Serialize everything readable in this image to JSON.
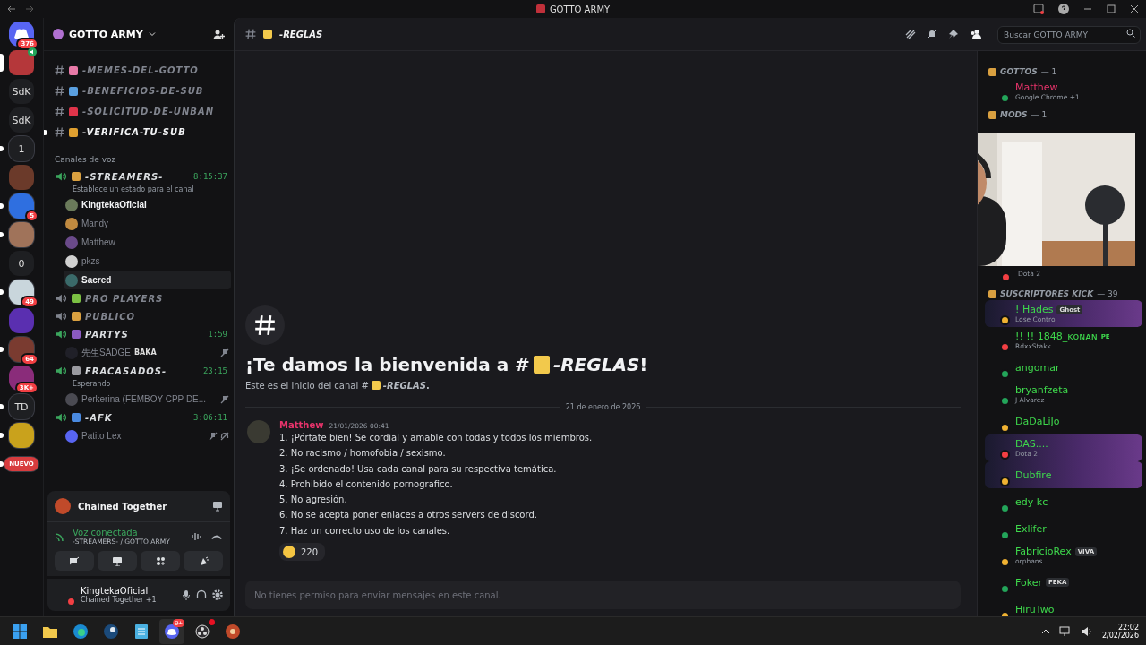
{
  "titlebar": {
    "title": "GOTTO ARMY"
  },
  "servers": [
    {
      "kind": "home",
      "badge": "376",
      "unread": false,
      "selected": false,
      "color": "#5865f2"
    },
    {
      "kind": "avatar",
      "color": "#b5373a",
      "unread": false,
      "selected": true,
      "speaking": true
    },
    {
      "kind": "text",
      "label": "SdK",
      "unread": false,
      "selected": false
    },
    {
      "kind": "text",
      "label": "SdK",
      "unread": false,
      "selected": false
    },
    {
      "kind": "text",
      "label": "1",
      "unread": true,
      "selected": false
    },
    {
      "kind": "avatar",
      "color": "#6b3a2a",
      "unread": false,
      "selected": false
    },
    {
      "kind": "avatar",
      "color": "#2f6fe0",
      "badge": "5",
      "unread": true,
      "selected": false
    },
    {
      "kind": "avatar",
      "color": "#a0735a",
      "unread": true,
      "selected": false
    },
    {
      "kind": "text",
      "label": "0",
      "unread": false,
      "selected": false
    },
    {
      "kind": "avatar",
      "color": "#c9d6dc",
      "badge": "49",
      "unread": true,
      "selected": false
    },
    {
      "kind": "avatar",
      "color": "#5a2fb0",
      "unread": false,
      "selected": false
    },
    {
      "kind": "avatar",
      "color": "#7a3b30",
      "badge": "64",
      "unread": true,
      "selected": false
    },
    {
      "kind": "avatar",
      "color": "#8a2c7a",
      "badge": "3K+",
      "unread": false,
      "selected": false
    },
    {
      "kind": "text",
      "label": "TD",
      "unread": true,
      "selected": false
    },
    {
      "kind": "avatar",
      "color": "#c9a21c",
      "unread": true,
      "selected": false
    },
    {
      "kind": "new",
      "label": "NUEVO",
      "unread": true,
      "selected": false
    }
  ],
  "guild": {
    "name": "GOTTO ARMY"
  },
  "text_channels": [
    {
      "name": "-MEMES-DEL-GOTTO",
      "color": "#e87aa8",
      "unread": false
    },
    {
      "name": "-BENEFICIOS-DE-SUB",
      "color": "#5aa0e0",
      "unread": false
    },
    {
      "name": "-SOLICITUD-DE-UNBAN",
      "color": "#e0344a",
      "unread": false
    },
    {
      "name": "-VERIFICA-TU-SUB",
      "color": "#e0a030",
      "unread": true
    }
  ],
  "voice_category": "Canales de voz",
  "voice_channels": [
    {
      "name": "-STREAMERS-",
      "color": "#d9a040",
      "active": true,
      "timer": "8:15:37",
      "status": "Establece un estado para el canal",
      "users": [
        {
          "name": "KingtekaOficial",
          "bright": true,
          "hovered": false,
          "muted": false,
          "deafened": false
        },
        {
          "name": "Mandy",
          "bright": false,
          "hovered": false,
          "muted": false,
          "deafened": false
        },
        {
          "name": "Matthew",
          "bright": false,
          "hovered": false,
          "muted": false,
          "deafened": false
        },
        {
          "name": "pkzs",
          "bright": false,
          "hovered": false,
          "muted": false,
          "deafened": false
        },
        {
          "name": "Sacred",
          "bright": true,
          "hovered": true,
          "muted": false,
          "deafened": false
        }
      ]
    },
    {
      "name": "PRO PLAYERS",
      "color": "#7bc043",
      "active": false
    },
    {
      "name": "PUBLICO",
      "color": "#d9a040",
      "active": false
    },
    {
      "name": "PARTYS",
      "color": "#8a5ac0",
      "active": true,
      "timer": "1:59",
      "users": [
        {
          "name": "先生SADGE",
          "tag": "BAKA",
          "bright": false,
          "hovered": false,
          "muted": true,
          "deafened": false
        }
      ]
    },
    {
      "name": "FRACASADOS-",
      "color": "#9a9aa0",
      "active": true,
      "timer": "23:15",
      "status": "Esperando",
      "users": [
        {
          "name": "Perkerina (FEMBOY CPP DE...",
          "bright": false,
          "hovered": false,
          "muted": true,
          "deafened": false
        }
      ]
    },
    {
      "name": "-AFK",
      "color": "#4a8ae0",
      "active": true,
      "timer": "3:06:11",
      "users": [
        {
          "name": "Patito Lex",
          "bright": false,
          "hovered": false,
          "muted": true,
          "deafened": true
        }
      ]
    }
  ],
  "activity_panel": {
    "title": "Chained Together"
  },
  "voice_panel": {
    "status": "Voz conectada",
    "channel": "-STREAMERS- / GOTTO ARMY"
  },
  "user_panel": {
    "name": "KingtekaOficial",
    "activity": "Chained Together +1"
  },
  "header": {
    "channel": "-REGLAS",
    "search_placeholder": "Buscar GOTTO ARMY"
  },
  "welcome": {
    "title_start": "¡Te damos la bienvenida a #",
    "title_channel": "*-REGLAS*!",
    "subtitle_start": "Este es el inicio del canal #",
    "subtitle_channel": "*-REGLAS*."
  },
  "date_divider": "21 de enero de 2026",
  "message": {
    "author": "Matthew",
    "time": "21/01/2026 00:41",
    "lines": [
      "1. ¡Pórtate bien! Se cordial y amable con todas y todos los miembros.",
      "2. No racismo / homofobia / sexismo.",
      "3. ¡Se ordenado! Usa cada canal para su respectiva temática.",
      "4. Prohibido el contenido pornografico.",
      "5. No agresión.",
      "6. No se acepta poner enlaces a otros servers de discord.",
      "7. Haz un correcto uso de los canales."
    ],
    "reaction_count": "220"
  },
  "composer": {
    "placeholder": "No tienes permiso para enviar mensajes en este canal.",
    "disabled": true
  },
  "member_sections": [
    {
      "title": "GOTTOS",
      "count": "— 1",
      "members": [
        {
          "kind": "full",
          "name": "Matthew",
          "color": "#e8336b",
          "activity": "Google Chrome +1",
          "status_dot": {
            "color": "#23a55a"
          },
          "banner": false
        }
      ]
    },
    {
      "title": "MODS",
      "count": "— 1",
      "members": [
        {
          "kind": "partial",
          "activity": "Dota 2",
          "status_dot": {
            "color": "#f23f43"
          }
        }
      ]
    },
    {
      "title": "SUSCRIPTORES KICK",
      "count": "— 39",
      "members": [
        {
          "kind": "full",
          "name": "! Hades",
          "color": "#3ed84c",
          "tag": "Ghost",
          "activity": "Lose Control",
          "status_dot": {
            "color": "#f0b232"
          },
          "banner": true
        },
        {
          "kind": "full",
          "name": "!! !! 1848_ᴋᴏɴᴀɴ",
          "color": "#3ed84c",
          "tag_plain": "PE",
          "activity": "RdxxStakk",
          "status_dot": {
            "color": "#f23f43"
          },
          "banner": false
        },
        {
          "kind": "full",
          "name": "angomar",
          "color": "#3ed84c",
          "status_dot": {
            "color": "#23a55a"
          },
          "banner": false
        },
        {
          "kind": "full",
          "name": "bryanfzeta",
          "color": "#3ed84c",
          "activity": "J Alvarez",
          "status_dot": {
            "color": "#23a55a"
          },
          "banner": false
        },
        {
          "kind": "full",
          "name": "DaDaLiJo",
          "color": "#3ed84c",
          "status_dot": {
            "color": "#f0b232"
          },
          "banner": false
        },
        {
          "kind": "full",
          "name": "DAS....",
          "color": "#3ed84c",
          "activity": "Dota 2",
          "status_dot": {
            "color": "#f23f43"
          },
          "banner": true
        },
        {
          "kind": "full",
          "name": "Dubfire",
          "color": "#3ed84c",
          "status_dot": {
            "color": "#f0b232"
          },
          "banner": true
        },
        {
          "kind": "full",
          "name": "edy kc",
          "color": "#3ed84c",
          "status_dot": {
            "color": "#23a55a"
          },
          "banner": false
        },
        {
          "kind": "full",
          "name": "Exlifer",
          "color": "#3ed84c",
          "status_dot": {
            "color": "#23a55a"
          },
          "banner": false
        },
        {
          "kind": "full",
          "name": "FabricioRex",
          "color": "#3ed84c",
          "tag": "VIVA",
          "activity": "orphans",
          "status_dot": {
            "color": "#f0b232"
          },
          "banner": false
        },
        {
          "kind": "full",
          "name": "Foker",
          "color": "#3ed84c",
          "tag": "FEKA",
          "status_dot": {
            "color": "#23a55a"
          },
          "banner": false
        },
        {
          "kind": "full",
          "name": "HiruTwo",
          "color": "#3ed84c",
          "status_dot": {
            "color": "#f0b232"
          },
          "banner": false
        }
      ]
    }
  ],
  "taskbar": {
    "apps": [
      {
        "kind": "start",
        "active": false
      },
      {
        "kind": "folder",
        "active": false
      },
      {
        "kind": "edge",
        "active": false
      },
      {
        "kind": "steam",
        "active": false
      },
      {
        "kind": "notepad",
        "active": false
      },
      {
        "kind": "discord",
        "active": true,
        "badge": "9+"
      },
      {
        "kind": "obs",
        "active": false,
        "alert": true
      },
      {
        "kind": "game",
        "active": false
      }
    ],
    "time": "22:02",
    "date": "2/02/2026"
  }
}
